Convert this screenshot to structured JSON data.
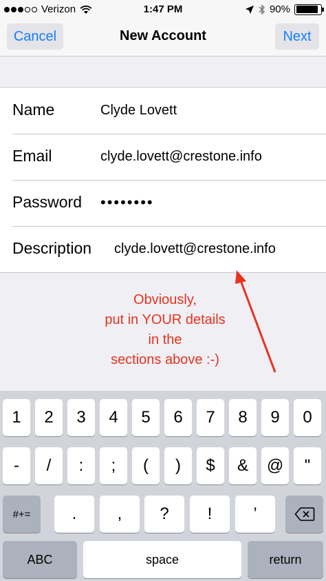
{
  "status_bar": {
    "carrier": "Verizon",
    "time": "1:47 PM",
    "battery": "90%",
    "battery_level": 0.9
  },
  "nav": {
    "cancel_label": "Cancel",
    "title": "New Account",
    "next_label": "Next"
  },
  "form": {
    "rows": [
      {
        "label": "Name",
        "value": "Clyde Lovett"
      },
      {
        "label": "Email",
        "value": "clyde.lovett@crestone.info"
      },
      {
        "label": "Password",
        "value": "••••••••"
      },
      {
        "label": "Description",
        "value": "clyde.lovett@crestone.info"
      }
    ]
  },
  "annotation": {
    "text": "Obviously,\nput in YOUR details\nin the\nsections above :-)",
    "color": "#e8321e"
  },
  "keyboard": {
    "row1": [
      "1",
      "2",
      "3",
      "4",
      "5",
      "6",
      "7",
      "8",
      "9",
      "0"
    ],
    "row2": [
      "-",
      "/",
      ":",
      ";",
      "(",
      ")",
      "$",
      "&",
      "@",
      "\""
    ],
    "row3": [
      ".",
      ",",
      "?",
      "!",
      "’"
    ],
    "symbols_label": "#+=",
    "abc_label": "ABC",
    "space_label": "space",
    "return_label": "return"
  },
  "colors": {
    "accent": "#147efb",
    "keyboard_bg": "#d1d5db"
  }
}
